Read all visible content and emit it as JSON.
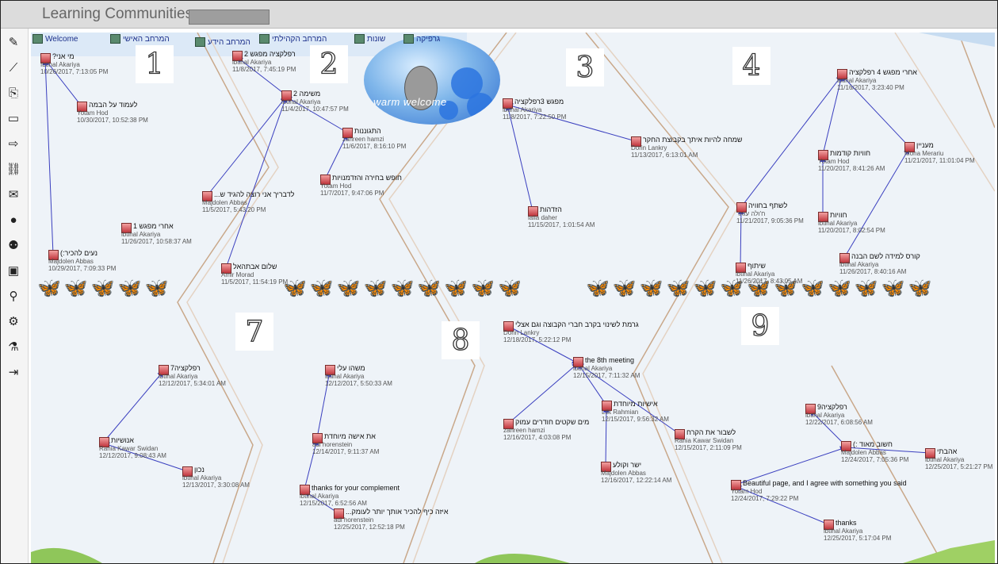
{
  "app": {
    "title": "Learning Communities"
  },
  "toolbar": [
    "pencil-icon",
    "brush-icon",
    "paperclip-icon",
    "window-icon",
    "signpost-icon",
    "link-icon",
    "envelope-icon",
    "person-icon",
    "people-icon",
    "toolbox-icon",
    "search-icon",
    "gear-icon",
    "flask-icon",
    "exit-icon"
  ],
  "tabs": [
    {
      "label": "Welcome"
    },
    {
      "label": "המרחב האישי"
    },
    {
      "label": "המרחב הידע"
    },
    {
      "label": "המרחב הקהילתי"
    },
    {
      "label": "שונות"
    },
    {
      "label": "גרפיקה"
    }
  ],
  "banner": {
    "text": "warm welcome"
  },
  "numbers": [
    "1",
    "2",
    "3",
    "4",
    "7",
    "8",
    "9"
  ],
  "notes": [
    {
      "title": "?מי אני",
      "author": "Ibtihal Akariya",
      "date": "10/26/2017, 7:13:05 PM"
    },
    {
      "title": "לעמוד על הבמה",
      "author": "Yotam Hod",
      "date": "10/30/2017, 10:52:38 PM"
    },
    {
      "title": "רפלקציה מפגש 2",
      "author": "ibtihal Akariya",
      "date": "11/8/2017, 7:45:19 PM"
    },
    {
      "title": "משימה 2",
      "author": "ibtihal Akariya",
      "date": "11/4/2017, 10:47:57 PM"
    },
    {
      "title": "התגוננות",
      "author": "zahreen hamzi",
      "date": "11/6/2017, 8:16:10 PM"
    },
    {
      "title": "חופש בחירה והזדמנויות",
      "author": "Yotam Hod",
      "date": "11/7/2017, 9:47:06 PM"
    },
    {
      "title": "...לדבריך אני רוצה להגיד ש",
      "author": "Majdolen Abbas",
      "date": "11/5/2017, 5:43:20 PM"
    },
    {
      "title": "אחרי מפגש 1",
      "author": "ibtihal Akariya",
      "date": "11/26/2017, 10:58:37 AM"
    },
    {
      "title": "(:נעים להכיר",
      "author": "Majdolen Abbas",
      "date": "10/29/2017, 7:09:33 PM"
    },
    {
      "title": "שלום אבתהאל",
      "author": "Amir Morad",
      "date": "11/5/2017, 11:54:19 PM"
    },
    {
      "title": "מפגש 3רפלקציה",
      "author": "ibtihal Akariya",
      "date": "11/8/2017, 7:22:50 PM"
    },
    {
      "title": "שמחה להיות איתך בקבוצת החקר",
      "author": "Dorin Lankry",
      "date": "11/13/2017, 6:13:01 AM"
    },
    {
      "title": "הזדהות",
      "author": "laila daher",
      "date": "11/15/2017, 1:01:54 AM"
    },
    {
      "title": "אחרי מפגש 4 רפלקציה",
      "author": "ibtihal Akariya",
      "date": "11/16/2017, 3:23:40 PM"
    },
    {
      "title": "חוויות קודמות",
      "author": "Yotam Hod",
      "date": "11/20/2017, 8:41:26 AM"
    },
    {
      "title": "מעניין",
      "author": "Mona Merariu",
      "date": "11/21/2017, 11:01:04 PM"
    },
    {
      "title": "לשתף בחוויה",
      "author": "ח'ולה עואד",
      "date": "11/21/2017, 9:05:36 PM"
    },
    {
      "title": "חוויות",
      "author": "ibtihal Akariya",
      "date": "11/20/2017, 8:02:54 PM"
    },
    {
      "title": "קורס למידה לשם הבנה",
      "author": "ibtihal Akariya",
      "date": "11/26/2017, 8:40:16 AM"
    },
    {
      "title": "שיתוף",
      "author": "ibtihal Akariya",
      "date": "11/26/2017, 8:43:05 AM"
    },
    {
      "title": "רפלקציה7",
      "author": "ibtihal Akariya",
      "date": "12/12/2017, 5:34:01 AM"
    },
    {
      "title": "אנושיות",
      "author": "Rania Kawar Swidan",
      "date": "12/12/2017, 9:08:43 AM"
    },
    {
      "title": "נכון",
      "author": "ibtihal Akariya",
      "date": "12/13/2017, 3:30:08 AM"
    },
    {
      "title": "משהו עלי",
      "author": "ibtihal Akariya",
      "date": "12/12/2017, 5:50:33 AM"
    },
    {
      "title": "את אישה מיוחדת",
      "author": "adi horenstein",
      "date": "12/14/2017, 9:11:37 AM"
    },
    {
      "title": "thanks for your complement",
      "author": "ibtihal Akariya",
      "date": "12/15/2017, 6:52:56 AM"
    },
    {
      "title": "...איזה כיף להכיר אותך יותר לעומק",
      "author": "adi horenstein",
      "date": "12/25/2017, 12:52:18 PM"
    },
    {
      "title": "גרמת לשינוי בקרב חברי הקבוצה וגם אצלי",
      "author": "Dorin Lankry",
      "date": "12/18/2017, 5:22:12 PM"
    },
    {
      "title": "the 8th meeting",
      "author": "ibtihal Akariya",
      "date": "12/15/2017, 7:11:32 AM"
    },
    {
      "title": "אישיות מיוחדת",
      "author": "Lilit Rahmian",
      "date": "12/15/2017, 9:56:32 AM"
    },
    {
      "title": "מים שקטים חודרים עמוק",
      "author": "zahreen hamzi",
      "date": "12/16/2017, 4:03:08 PM"
    },
    {
      "title": "לשבור את הקרח",
      "author": "Rania Kawar Swidan",
      "date": "12/15/2017, 2:11:09 PM"
    },
    {
      "title": "ישר וקולע",
      "author": "Majdolen Abbas",
      "date": "12/16/2017, 12:22:14 AM"
    },
    {
      "title": "רפלקציה9",
      "author": "ibtihal Akariya",
      "date": "12/22/2017, 6:08:56 AM"
    },
    {
      "title": "(: חשוב מאוד",
      "author": "Majdolen Abbas",
      "date": "12/24/2017, 7:05:36 PM"
    },
    {
      "title": "אהבתי",
      "author": "ibtihal Akariya",
      "date": "12/25/2017, 5:21:27 PM"
    },
    {
      "title": "Beautiful page, and I agree with something you said",
      "author": "Yotam Hod",
      "date": "12/24/2017, 7:29:22 PM"
    },
    {
      "title": "thanks",
      "author": "ibtihal Akariya",
      "date": "12/25/2017, 5:17:04 PM"
    }
  ],
  "colors": {
    "link": "#3a3fbf",
    "titlebar": "#dcdcdc",
    "canvas": "#eef3f8",
    "accent": "#1b2f8a"
  }
}
